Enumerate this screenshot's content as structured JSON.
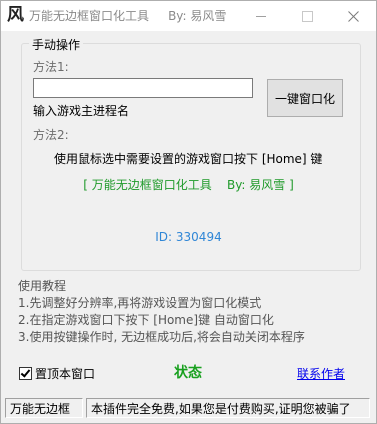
{
  "window": {
    "title": "万能无边框窗口化工具     By: 易风雪",
    "icon_glyph": "风"
  },
  "group": {
    "title": "手动操作",
    "method1_label": "方法1:",
    "process_input_value": "",
    "process_input_caption": "输入游戏主进程名",
    "windowize_button": "一键窗口化",
    "method2_label": "方法2:",
    "method2_instruction": "使用鼠标选中需要设置的游戏窗口按下 [Home] 键",
    "brand_line": "[ 万能无边框窗口化工具    By: 易风雪 ]",
    "id_line": "ID: 330494"
  },
  "tips": {
    "title": "使用教程",
    "items": [
      "1.先调整好分辨率,再将游戏设置为窗口化模式",
      "2.在指定游戏窗口下按下 [Home]键 自动窗口化",
      "3.使用按键操作时, 无边框成功后,将会自动关闭本程序"
    ]
  },
  "footer": {
    "topmost_checkbox_label": "置顶本窗口",
    "topmost_checked": true,
    "status_label": "状态",
    "contact_link": "联系作者"
  },
  "statusbar": {
    "left": "万能无边框",
    "right": "本插件完全免费,如果您是付费购买,证明您被骗了"
  },
  "colors": {
    "brand_green": "#1f9a2a",
    "id_blue": "#2f86d6",
    "status_green": "#18a01e",
    "link_blue": "#0000ee"
  }
}
